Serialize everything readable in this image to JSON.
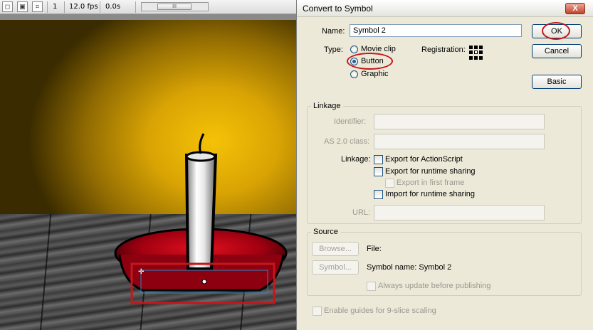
{
  "toolbar": {
    "icons": [
      "edit-scene-icon",
      "edit-symbols-icon",
      "fit-icon"
    ],
    "frame": "1",
    "fps": "12.0 fps",
    "time": "0.0s",
    "scroll_grip": "III"
  },
  "dialog": {
    "title": "Convert to Symbol",
    "close_label": "X",
    "name_label": "Name:",
    "name_value": "Symbol 2",
    "type_label": "Type:",
    "types": [
      {
        "label": "Movie clip",
        "checked": false
      },
      {
        "label": "Button",
        "checked": true
      },
      {
        "label": "Graphic",
        "checked": false
      }
    ],
    "registration_label": "Registration:",
    "ok_label": "OK",
    "cancel_label": "Cancel",
    "basic_label": "Basic",
    "linkage": {
      "title": "Linkage",
      "identifier_label": "Identifier:",
      "as_class_label": "AS 2.0 class:",
      "linkage_label": "Linkage:",
      "checkboxes": [
        {
          "label": "Export for ActionScript",
          "enabled": true
        },
        {
          "label": "Export for runtime sharing",
          "enabled": true
        },
        {
          "label": "Export in first frame",
          "enabled": false
        },
        {
          "label": "Import for runtime sharing",
          "enabled": true
        }
      ],
      "url_label": "URL:"
    },
    "source": {
      "title": "Source",
      "browse_label": "Browse...",
      "file_label": "File:",
      "symbol_label": "Symbol...",
      "symbol_name": "Symbol name: Symbol 2",
      "always_update_label": "Always update before publishing"
    },
    "nine_slice_label": "Enable guides for 9-slice scaling"
  },
  "colors": {
    "annotation": "#c4161c",
    "wall": "#f5c206",
    "candle_dish": "#b00010"
  }
}
